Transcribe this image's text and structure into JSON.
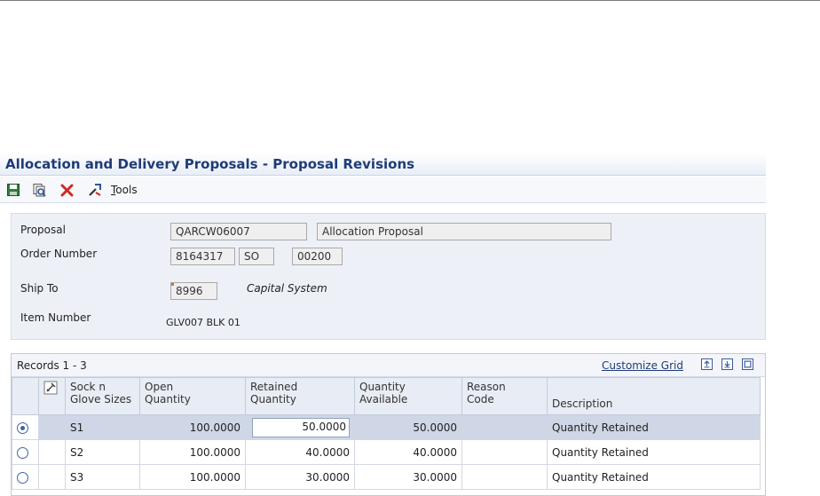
{
  "window": {
    "title": "Allocation and Delivery Proposals - Proposal Revisions"
  },
  "toolbar": {
    "tools_label_first": "T",
    "tools_label_rest": "ools"
  },
  "header": {
    "proposal_label": "Proposal",
    "proposal_value": "QARCW06007",
    "proposal_type": "Allocation Proposal",
    "order_number_label": "Order Number",
    "order_number": "8164317",
    "order_type": "SO",
    "order_company": "00200",
    "ship_to_label": "Ship To",
    "ship_to_value": "8996",
    "ship_to_name": "Capital System",
    "item_number_label": "Item Number",
    "item_number_value": "GLV007 BLK 01"
  },
  "grid": {
    "records_label": "Records 1 - 3",
    "customize_label": "Customize Grid",
    "columns": {
      "size": [
        "Sock n",
        "Glove Sizes"
      ],
      "open": [
        "Open",
        "Quantity"
      ],
      "retained": [
        "Retained",
        "Quantity"
      ],
      "available": [
        "Quantity",
        "Available"
      ],
      "reason": [
        "Reason",
        "Code"
      ],
      "description": "Description"
    },
    "rows": [
      {
        "size": "S1",
        "open": "100.0000",
        "retained": "50.0000",
        "available": "50.0000",
        "reason": "",
        "description": "Quantity Retained"
      },
      {
        "size": "S2",
        "open": "100.0000",
        "retained": "40.0000",
        "available": "40.0000",
        "reason": "",
        "description": "Quantity Retained"
      },
      {
        "size": "S3",
        "open": "100.0000",
        "retained": "30.0000",
        "available": "30.0000",
        "reason": "",
        "description": "Quantity Retained"
      }
    ]
  },
  "colors": {
    "title": "#1f3c78",
    "accent": "#3f63a8",
    "delete": "#d12a1f",
    "marker": "#e06c1f"
  }
}
